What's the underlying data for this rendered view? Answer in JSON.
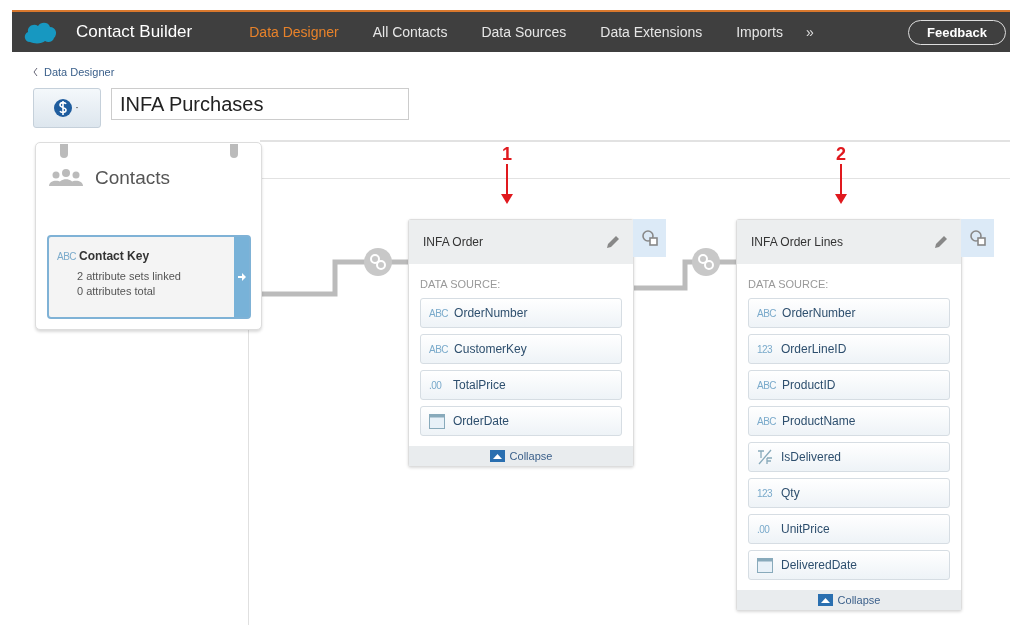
{
  "app": {
    "title": "Contact Builder"
  },
  "nav_tabs": [
    {
      "label": "Data Designer",
      "selected": true
    },
    {
      "label": "All Contacts",
      "selected": false
    },
    {
      "label": "Data Sources",
      "selected": false
    },
    {
      "label": "Data Extensions",
      "selected": false
    },
    {
      "label": "Imports",
      "selected": false
    }
  ],
  "nav_more": "»",
  "feedback_button": "Feedback",
  "breadcrumb": "Data Designer",
  "attribute_group_name": "INFA Purchases",
  "contacts_card": {
    "title": "Contacts",
    "key": {
      "type_label": "ABC",
      "name": "Contact Key",
      "lines": [
        "2 attribute sets linked",
        "0 attributes total"
      ]
    }
  },
  "annotations": [
    "1",
    "2"
  ],
  "data_extensions": [
    {
      "title": "INFA Order",
      "source_label": "DATA SOURCE:",
      "collapse": "Collapse",
      "fields": [
        {
          "kind": "text",
          "type_label": "ABC",
          "name": "OrderNumber"
        },
        {
          "kind": "text",
          "type_label": "ABC",
          "name": "CustomerKey"
        },
        {
          "kind": "decimal",
          "type_label": ".00",
          "name": "TotalPrice"
        },
        {
          "kind": "date",
          "name": "OrderDate"
        }
      ]
    },
    {
      "title": "INFA Order Lines",
      "source_label": "DATA SOURCE:",
      "collapse": "Collapse",
      "fields": [
        {
          "kind": "text",
          "type_label": "ABC",
          "name": "OrderNumber"
        },
        {
          "kind": "number",
          "type_label": "123",
          "name": "OrderLineID"
        },
        {
          "kind": "text",
          "type_label": "ABC",
          "name": "ProductID"
        },
        {
          "kind": "text",
          "type_label": "ABC",
          "name": "ProductName"
        },
        {
          "kind": "boolean",
          "name": "IsDelivered"
        },
        {
          "kind": "number",
          "type_label": "123",
          "name": "Qty"
        },
        {
          "kind": "decimal",
          "type_label": ".00",
          "name": "UnitPrice"
        },
        {
          "kind": "date",
          "name": "DeliveredDate"
        }
      ]
    }
  ]
}
